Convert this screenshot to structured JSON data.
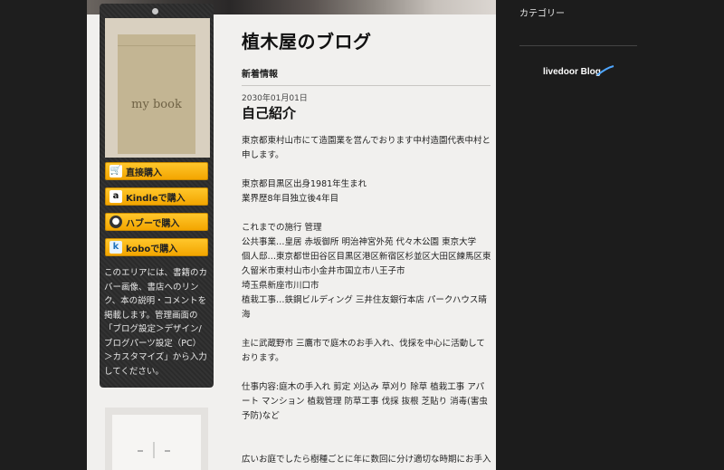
{
  "blog": {
    "title": "植木屋のブログ"
  },
  "book": {
    "cover_title": "my book",
    "buy_buttons": [
      {
        "label": "直接購入",
        "icon": "cart-icon",
        "icon_text": "🛒"
      },
      {
        "label": "Kindleで購入",
        "icon": "amazon-icon",
        "icon_text": "a"
      },
      {
        "label": "ハブーで購入",
        "icon": "hoobee-icon",
        "icon_text": "●"
      },
      {
        "label": "koboで購入",
        "icon": "kobo-icon",
        "icon_text": "k"
      }
    ],
    "info_text": [
      "このエリアには、書籍のカ",
      "バー画像、書店へのリン",
      "ク、本の説明・コメントを",
      "掲載します。管理画面の",
      "「ブログ設定＞デザイン/",
      "ブログパーツ設定（PC）",
      "＞カスタマイズ」から入力",
      "してください。"
    ]
  },
  "main": {
    "section_label": "新着情報",
    "post": {
      "date": "2030年01月01日",
      "title": "自己紹介",
      "paragraphs": [
        [
          "東京都東村山市にて造園業を営んでおります中村造園代表中村と",
          "申します。"
        ],
        [
          "東京都目黒区出身1981年生まれ",
          "業界歴8年目独立後4年目"
        ],
        [
          "これまでの施行 管理",
          "公共事業…皇居 赤坂御所 明治神宮外苑 代々木公園 東京大学",
          "個人邸…東京都世田谷区目黒区港区新宿区杉並区大田区練馬区東",
          "久留米市東村山市小金井市国立市八王子市",
          "埼玉県新座市川口市",
          "植栽工事…鉄鋼ビルディング 三井住友銀行本店 パークハウス晴",
          "海"
        ],
        [
          "主に武蔵野市 三鷹市で庭木のお手入れ、伐採を中心に活動して",
          "おります。"
        ],
        [
          "仕事内容:庭木の手入れ 剪定 刈込み 草刈り 除草 植栽工事 アパ",
          "ート マンション 植栽管理 防草工事 伐採 抜根 芝貼り 消毒(害虫",
          "予防)など"
        ],
        [
          "広いお庭でしたら樹種ごとに年に数回に分け適切な時期にお手入"
        ]
      ]
    }
  },
  "sidebar": {
    "category_label": "カテゴリー",
    "logo_text": "livedoor Blog"
  },
  "colors": {
    "button": "#f3a500",
    "paper": "#f1f0ee",
    "background": "#1c1c1c",
    "panel": "#2b2b2b"
  }
}
